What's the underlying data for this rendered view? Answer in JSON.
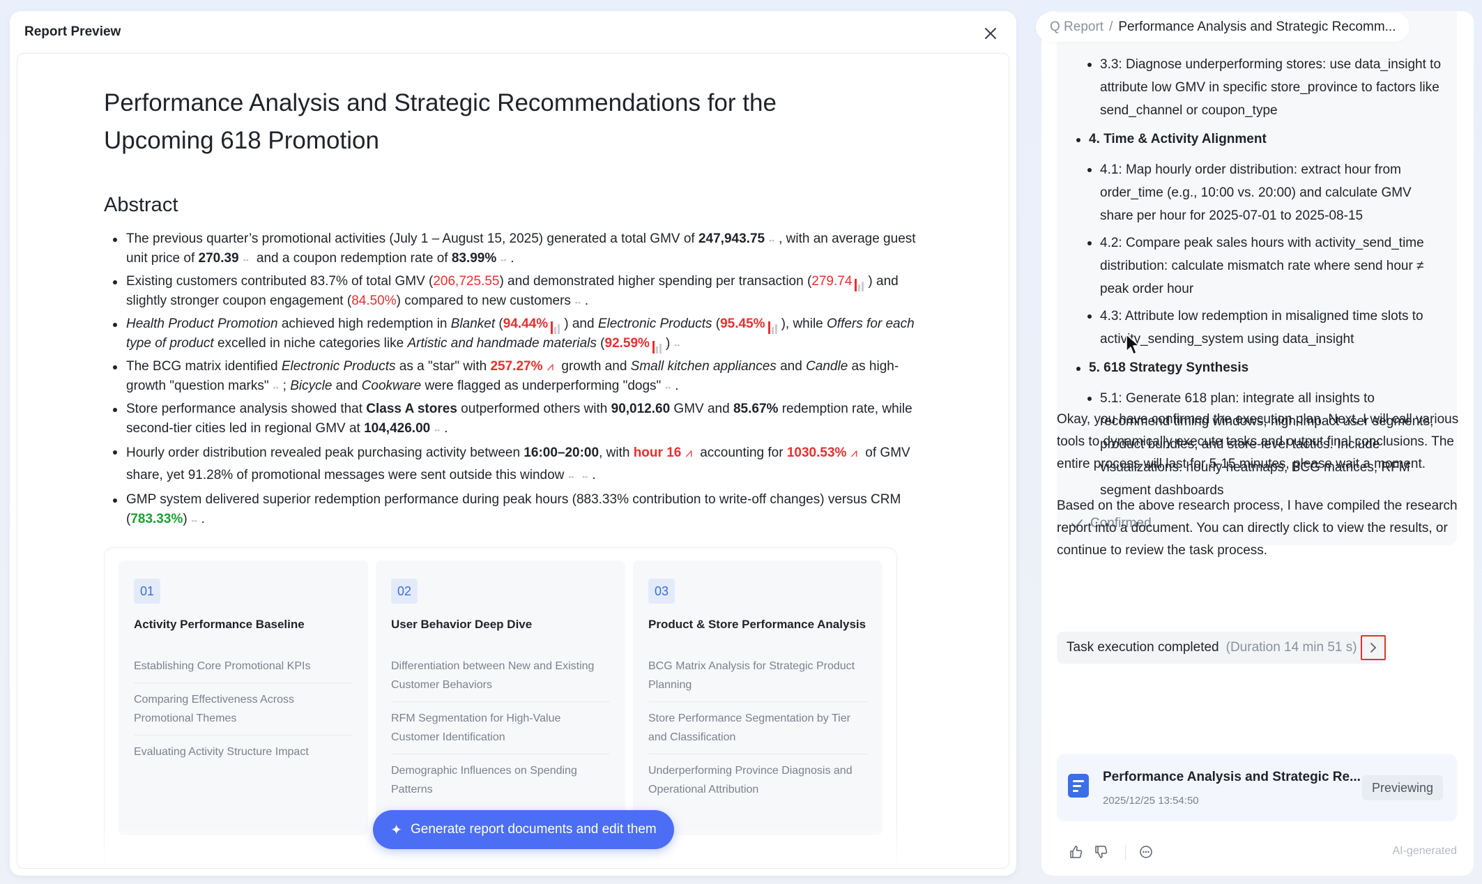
{
  "preview": {
    "title": "Report Preview",
    "doc_title": "Performance Analysis and Strategic Recommendations for the Upcoming 618 Promotion",
    "abstract_heading": "Abstract",
    "bullets": {
      "b1": {
        "t1": "The previous quarter’s promotional activities (July 1 – August 15, 2025) generated a total GMV of ",
        "v1": "247,943.75",
        "t2": ", with an average guest unit price of ",
        "v2": "270.39",
        "t3": " and a coupon redemption rate of ",
        "v3": "83.99%",
        "t4": "."
      },
      "b2": {
        "t1": "Existing customers contributed 83.7% of total GMV (",
        "v1": "206,725.55",
        "t2": ") and demonstrated higher spending per transaction (",
        "v2": "279.74",
        "t3": ") and slightly stronger coupon engagement (",
        "v3": "84.50%",
        "t4": ") compared to new customers",
        "t5": "."
      },
      "b3": {
        "e1": "Health Product Promotion",
        "t1": " achieved high redemption in ",
        "e2": "Blanket",
        "t2": " (",
        "v1": "94.44%",
        "t3": ") and ",
        "e3": "Electronic Products",
        "t4": " (",
        "v2": "95.45%",
        "t5": "), while ",
        "e4": "Offers for each type of product",
        "t6": " excelled in niche categories like ",
        "e5": "Artistic and handmade materials",
        "t7": " (",
        "v3": "92.59%",
        "t8": ")"
      },
      "b4": {
        "t1": "The BCG matrix identified ",
        "e1": "Electronic Products",
        "t2": " as a \"star\" with ",
        "v1": "257.27%",
        "t3": " growth and ",
        "e2": "Small kitchen appliances",
        "t4": " and ",
        "e3": "Candle",
        "t5": " as high-growth \"question marks\"",
        "t6": "; ",
        "e4": "Bicycle",
        "t7": " and ",
        "e5": "Cookware",
        "t8": " were flagged as underperforming \"dogs\"",
        "t9": "."
      },
      "b5": {
        "t1": "Store performance analysis showed that ",
        "v1": "Class A stores",
        "t2": " outperformed others with ",
        "v2": "90,012.60",
        "t3": " GMV and ",
        "v3": "85.67%",
        "t4": " redemption rate, while second-tier cities led in regional GMV at ",
        "v4": "104,426.00",
        "t5": "."
      },
      "b6": {
        "t1": "Hourly order distribution revealed peak purchasing activity between ",
        "v1": "16:00–20:00",
        "t2": ", with ",
        "v2": "hour 16",
        "t3": " accounting for ",
        "v3": "1030.53%",
        "t4": " of GMV share, yet 91.28% of promotional messages were sent outside this window",
        "t5": "."
      },
      "b7": {
        "t1": "GMP system delivered superior redemption performance during peak hours (883.33% contribution to write-off changes) versus CRM (",
        "v1": "783.33%",
        "t2": ")",
        "t3": "."
      }
    },
    "cards": [
      {
        "num": "01",
        "title": "Activity Performance Baseline",
        "items": [
          "Establishing Core Promotional KPIs",
          "Comparing Effectiveness Across Promotional Themes",
          "Evaluating Activity Structure Impact"
        ]
      },
      {
        "num": "02",
        "title": "User Behavior Deep Dive",
        "items": [
          "Differentiation between New and Existing Customer Behaviors",
          "RFM Segmentation for High-Value Customer Identification",
          "Demographic Influences on Spending Patterns"
        ]
      },
      {
        "num": "03",
        "title": "Product & Store Performance Analysis",
        "items": [
          "BCG Matrix Analysis for Strategic Product Planning",
          "Store Performance Segmentation by Tier and Classification",
          "Underperforming Province Diagnosis and Operational Attribution"
        ]
      }
    ],
    "generate_button": "Generate report documents and edit them"
  },
  "breadcrumb": {
    "root": "Q Report",
    "sep": "/",
    "current": "Performance Analysis and Strategic Recomm..."
  },
  "plan": {
    "item_3_3": {
      "label": "3.3",
      "text": ": Diagnose underperforming stores: use data_insight to attribute low GMV in specific store_province to factors like send_channel or coupon_type"
    },
    "sec4": {
      "num": "4.",
      "title": "Time & Activity Alignment"
    },
    "item_4_1": {
      "label": "4.1",
      "text": ": Map hourly order distribution: extract hour from order_time (e.g., 10:00 vs. 20:00) and calculate GMV share per hour for 2025-07-01 to 2025-08-15"
    },
    "item_4_2": {
      "label": "4.2",
      "text": ": Compare peak sales hours with activity_send_time distribution: calculate mismatch rate where send hour ≠ peak order hour"
    },
    "item_4_3": {
      "label": "4.3",
      "text": ": Attribute low redemption in misaligned time slots to activity_sending_system using data_insight"
    },
    "sec5": {
      "num": "5.",
      "title": "618 Strategy Synthesis"
    },
    "item_5_1": {
      "label": "5.1",
      "text": ": Generate 618 plan: integrate all insights to recommend timing windows, high-impact user segments, product bundles, and store-level tactics. Include visualizations: hourly heatmaps, BCG matrices, RFM segment dashboards"
    },
    "confirmed": "Confirmed"
  },
  "chat": {
    "msg1": "Okay, you have confirmed the execution plan. Next, I will call various tools to dynamically execute tasks and output final conclusions. The entire process will last for 5-15 minutes, please wait a moment.",
    "task_status": "Task execution completed",
    "task_duration": "(Duration 14 min 51 s)",
    "msg2": "Based on the above research process, I have compiled the research report into a document. You can directly click to view the results, or continue to review the task process.",
    "doc_name": "Performance Analysis and Strategic Re...",
    "doc_time": "2025/12/25 13:54:50",
    "doc_status": "Previewing",
    "ai_generated": "AI-generated"
  },
  "colors": {
    "accent": "#4c6ef5",
    "highlight_red": "#e5312f",
    "highlight_green": "#1aa034",
    "doc_icon": "#3b6fe8"
  },
  "icons": [
    "close-icon",
    "link-icon",
    "bar-chart-icon",
    "trend-icon",
    "sparkle-icon",
    "check-icon",
    "chevron-right-icon",
    "document-icon",
    "thumbs-up-icon",
    "thumbs-down-icon",
    "more-icon",
    "mouse-cursor-icon"
  ]
}
